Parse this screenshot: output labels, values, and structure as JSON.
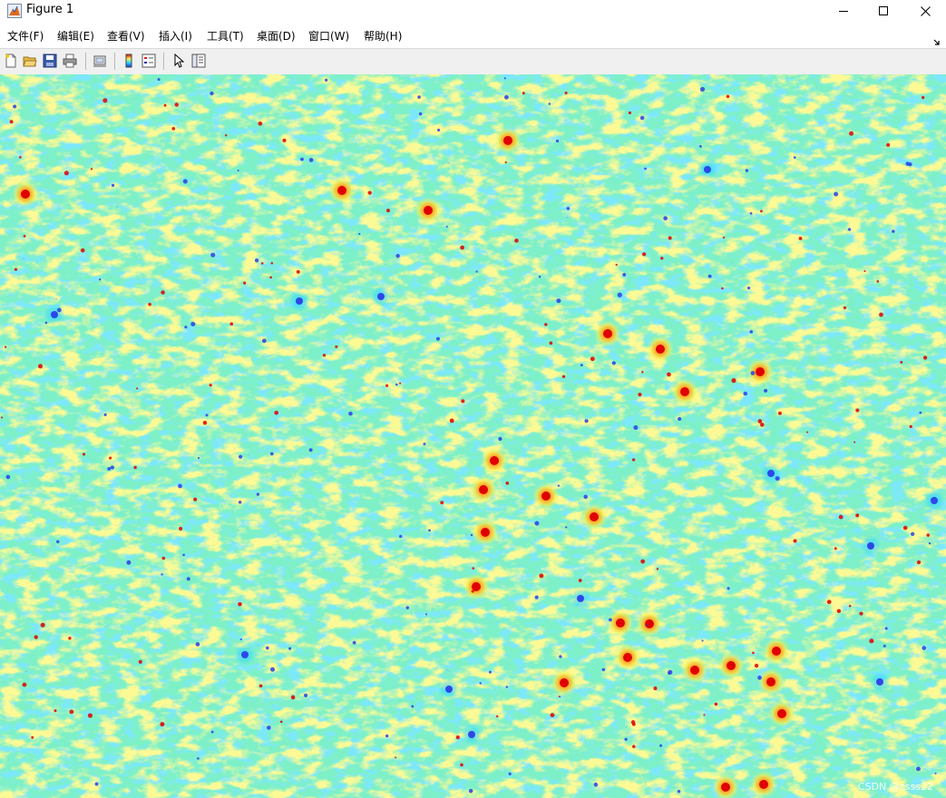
{
  "window": {
    "title": "Figure 1",
    "icon": "matlab-figure-icon",
    "controls": [
      "minimize-icon",
      "maximize-icon",
      "close-icon"
    ]
  },
  "menubar": {
    "items": [
      {
        "label": "文件(F)"
      },
      {
        "label": "编辑(E)"
      },
      {
        "label": "查看(V)"
      },
      {
        "label": "插入(I)"
      },
      {
        "label": "工具(T)"
      },
      {
        "label": "桌面(D)"
      },
      {
        "label": "窗口(W)"
      },
      {
        "label": "帮助(H)"
      }
    ],
    "dock_icon": "dock-arrow-icon"
  },
  "toolbar": {
    "tools": [
      {
        "icon": "new-figure-icon"
      },
      {
        "icon": "open-file-icon"
      },
      {
        "icon": "save-icon"
      },
      {
        "icon": "print-icon"
      },
      {
        "icon": "link-plot-icon"
      },
      {
        "icon": "insert-colorbar-icon"
      },
      {
        "icon": "insert-legend-icon"
      },
      {
        "icon": "edit-plot-pointer-icon"
      },
      {
        "icon": "property-inspector-icon"
      }
    ]
  },
  "figure": {
    "content": "jet-colormap-image",
    "colors": {
      "background_cyan": "#7ef0c8",
      "cyan": "#36d7ff",
      "yellow": "#f3f35a",
      "orange": "#ff9a1a",
      "red": "#e00000",
      "blue": "#2a3fe8"
    },
    "watermark": "CSDN @csss22"
  }
}
